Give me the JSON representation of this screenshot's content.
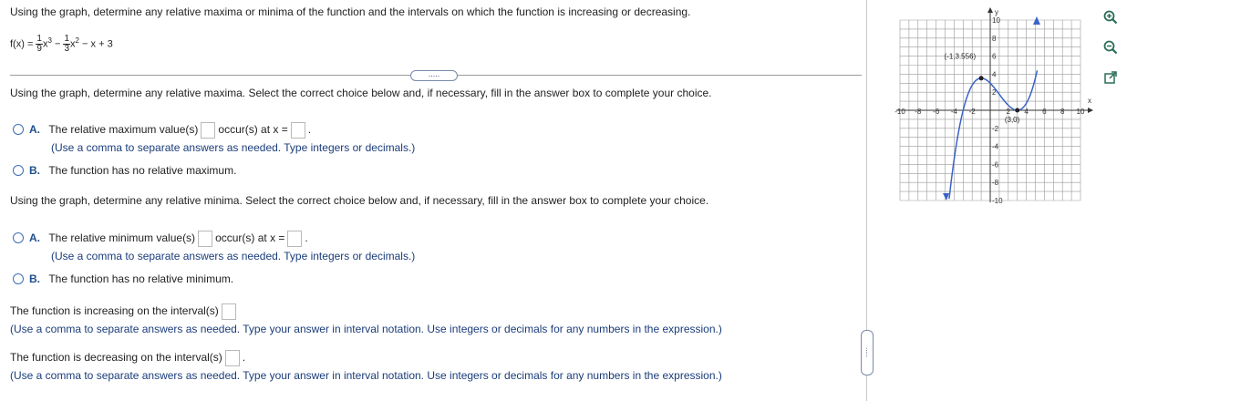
{
  "question": {
    "prompt": "Using the graph, determine any relative maxima or minima of the function and the intervals on which the function is increasing or decreasing.",
    "function": {
      "prefix": "f(x) = ",
      "term1_num": "1",
      "term1_den": "9",
      "term1_var": "x",
      "term1_exp": "3",
      "minus1": " − ",
      "term2_num": "1",
      "term2_den": "3",
      "term2_var": "x",
      "term2_exp": "2",
      "rest": " − x + 3"
    },
    "expand_button": "....."
  },
  "maxima": {
    "instruction": "Using the graph, determine any relative maxima. Select the correct choice below and, if necessary, fill in the answer box to complete your choice.",
    "option_a": {
      "letter": "A.",
      "text_before": "The relative maximum value(s)",
      "text_mid": "occur(s) at x =",
      "text_after": ".",
      "note": "(Use a comma to separate answers as needed. Type integers or decimals.)"
    },
    "option_b": {
      "letter": "B.",
      "text": "The function has no relative maximum."
    }
  },
  "minima": {
    "instruction": "Using the graph, determine any relative minima. Select the correct choice below and, if necessary, fill in the answer box to complete your choice.",
    "option_a": {
      "letter": "A.",
      "text_before": "The relative minimum value(s)",
      "text_mid": "occur(s) at x =",
      "text_after": ".",
      "note": "(Use a comma to separate answers as needed. Type integers or decimals.)"
    },
    "option_b": {
      "letter": "B.",
      "text": "The function has no relative minimum."
    }
  },
  "increasing": {
    "label": "The function is increasing on the interval(s)",
    "note": "(Use a comma to separate answers as needed. Type your answer in interval notation. Use integers or decimals for any numbers in the expression.)"
  },
  "decreasing": {
    "label": "The function is decreasing on the interval(s)",
    "after": ".",
    "note": "(Use a comma to separate answers as needed. Type your answer in interval notation. Use integers or decimals for any numbers in the expression.)"
  },
  "side_toggle": ".....",
  "graph": {
    "x_axis_label": "x",
    "y_axis_label": "y",
    "x_tick_labels": [
      "-10",
      "-8",
      "-6",
      "-4",
      "-2",
      "2",
      "4",
      "6",
      "8",
      "10"
    ],
    "y_tick_labels": [
      "10",
      "8",
      "6",
      "4",
      "2",
      "-2",
      "-4",
      "-6",
      "-8",
      "-10"
    ],
    "point_max_label": "(-1,3.556)",
    "point_min_label": "(3,0)",
    "xlim": [
      -10,
      10
    ],
    "ylim": [
      -10,
      10
    ],
    "curve_color": "#3a63c8",
    "grid_color": "#9a9a9a"
  },
  "tools": {
    "zoom_in": "zoom-in-icon",
    "zoom_out": "zoom-out-icon",
    "popout": "popout-icon"
  },
  "colors": {
    "option_letter": "#1e4d8c",
    "note_text": "#1a3c7a",
    "radio_border": "#3d6fb3"
  }
}
